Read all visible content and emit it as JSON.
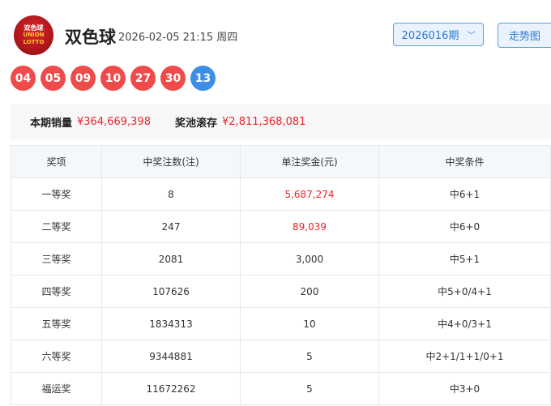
{
  "header": {
    "logo_text": "双色球 UNION LOTTO",
    "title": "双色球",
    "datetime": "2026-02-05 21:15 周四",
    "issue": "2026016期",
    "trend_button": "走势图"
  },
  "balls": {
    "red": [
      "04",
      "05",
      "09",
      "10",
      "27",
      "30"
    ],
    "blue": "13"
  },
  "summary": {
    "sales_label": "本期销量",
    "sales_value": "¥364,669,398",
    "pool_label": "奖池滚存",
    "pool_value": "¥2,811,368,081"
  },
  "table": {
    "headers": [
      "奖项",
      "中奖注数(注)",
      "单注奖金(元)",
      "中奖条件"
    ],
    "rows": [
      [
        "一等奖",
        "8",
        "5,687,274",
        "中6+1"
      ],
      [
        "二等奖",
        "247",
        "89,039",
        "中6+0"
      ],
      [
        "三等奖",
        "2081",
        "3,000",
        "中5+1"
      ],
      [
        "四等奖",
        "107626",
        "200",
        "中5+0/4+1"
      ],
      [
        "五等奖",
        "1834313",
        "10",
        "中4+0/3+1"
      ],
      [
        "六等奖",
        "9344881",
        "5",
        "中2+1/1+1/0+1"
      ],
      [
        "福运奖",
        "11672262",
        "5",
        "中3+0"
      ]
    ]
  },
  "colors": {
    "red_ball": "#f04b4b",
    "blue_ball": "#3d8fe6",
    "accent": "#2b7ad0",
    "money": "#e8242a"
  }
}
